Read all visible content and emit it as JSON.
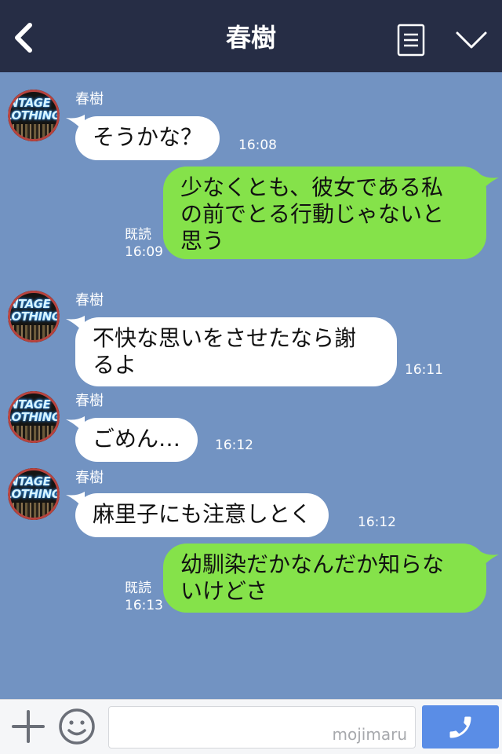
{
  "header": {
    "title": "春樹",
    "back_icon": "chevron-left-icon",
    "memo_icon": "note-icon",
    "menu_icon": "chevron-down-icon"
  },
  "avatar": {
    "line1": "INTAGE",
    "line2": "LOTHING"
  },
  "messages": [
    {
      "side": "left",
      "sender": "春樹",
      "text": "そうかな？",
      "time": "16:08"
    },
    {
      "side": "right",
      "text": "少なくとも、彼女である私\nの前でとる行動じゃないと\n思う",
      "read": "既読",
      "time": "16:09"
    },
    {
      "side": "left",
      "sender": "春樹",
      "text": "不快な思いをさせたなら謝\nるよ",
      "time": "16:11"
    },
    {
      "side": "left",
      "sender": "春樹",
      "text": "ごめん…",
      "time": "16:12"
    },
    {
      "side": "left",
      "sender": "春樹",
      "text": "麻里子にも注意しとく",
      "time": "16:12"
    },
    {
      "side": "right",
      "text": "幼馴染だかなんだか知らな\nいけどさ",
      "read": "既読",
      "time": "16:13"
    }
  ],
  "input": {
    "value": "",
    "watermark": "mojimaru"
  },
  "colors": {
    "header_bg": "#262d45",
    "chat_bg": "#7293c2",
    "bubble_mine": "#85e24a",
    "bubble_theirs": "#ffffff",
    "call_button": "#5a8de6"
  }
}
